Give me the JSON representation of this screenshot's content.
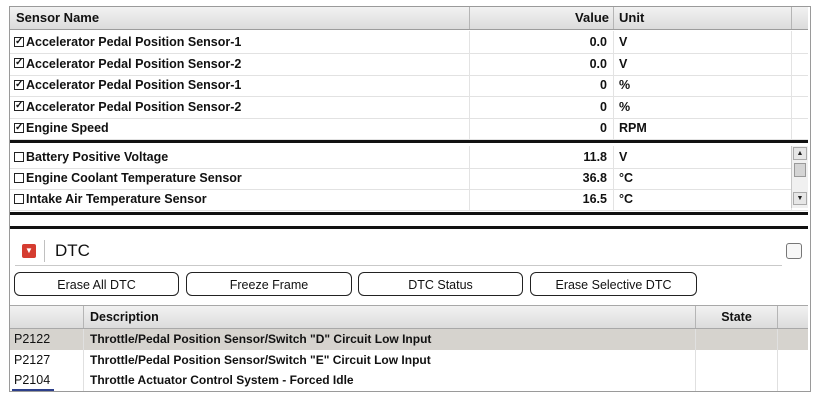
{
  "sensor_table": {
    "headers": {
      "name": "Sensor Name",
      "value": "Value",
      "unit": "Unit"
    },
    "pinned_rows": [
      {
        "name": "Accelerator Pedal Position Sensor-1",
        "value": "0.0",
        "unit": "V",
        "checked": true
      },
      {
        "name": "Accelerator Pedal Position Sensor-2",
        "value": "0.0",
        "unit": "V",
        "checked": true
      },
      {
        "name": "Accelerator Pedal Position Sensor-1",
        "value": "0",
        "unit": "%",
        "checked": true
      },
      {
        "name": "Accelerator Pedal Position Sensor-2",
        "value": "0",
        "unit": "%",
        "checked": true
      },
      {
        "name": "Engine Speed",
        "value": "0",
        "unit": "RPM",
        "checked": true
      }
    ],
    "rows": [
      {
        "name": "Battery Positive Voltage",
        "value": "11.8",
        "unit": "V",
        "checked": false
      },
      {
        "name": "Engine Coolant Temperature Sensor",
        "value": "36.8",
        "unit": "°C",
        "checked": false
      },
      {
        "name": "Intake Air Temperature Sensor",
        "value": "16.5",
        "unit": "°C",
        "checked": false
      }
    ]
  },
  "dtc": {
    "title": "DTC",
    "buttons": {
      "erase_all": "Erase All DTC",
      "freeze_frame": "Freeze Frame",
      "dtc_status": "DTC Status",
      "erase_selective": "Erase Selective DTC"
    },
    "headers": {
      "code": "",
      "description": "Description",
      "state": "State"
    },
    "rows": [
      {
        "code": "P2122",
        "description": "Throttle/Pedal Position Sensor/Switch \"D\" Circuit Low Input",
        "state": "",
        "selected": true
      },
      {
        "code": "P2127",
        "description": "Throttle/Pedal Position Sensor/Switch \"E\" Circuit Low Input",
        "state": "",
        "selected": false
      },
      {
        "code": "P2104",
        "description": "Throttle Actuator Control System - Forced Idle",
        "state": "",
        "selected": false
      }
    ]
  },
  "icons": {
    "dtc_toggle": "collapse-arrow-icon",
    "panel_toggle": "panel-toggle-icon"
  },
  "colors": {
    "dtc_icon": "#d53c30",
    "selected_row": "#d6d3ce"
  }
}
